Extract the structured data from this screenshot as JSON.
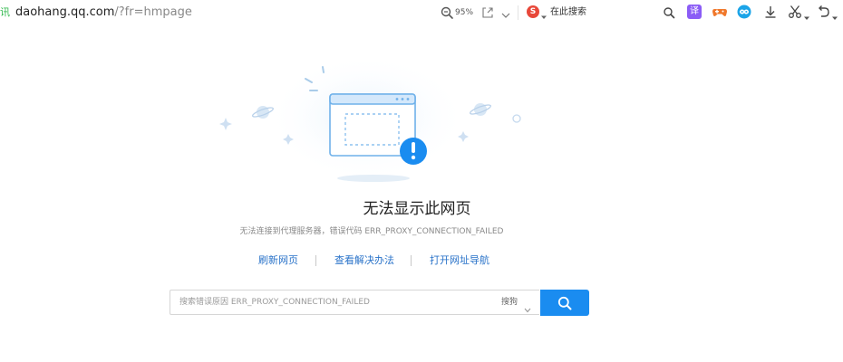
{
  "toolbar": {
    "prefix_text": "讯",
    "address_host": "daohang.qq.com",
    "address_path": "/?fr=hmpage",
    "zoom_level": "95%",
    "engine_logo_text": "S",
    "search_label": "在此搜索",
    "translate_ext_text": "译",
    "icons": [
      "zoom-icon",
      "share-icon",
      "chevron-down-icon",
      "sogou-logo",
      "search-icon",
      "translate-icon",
      "game-icon",
      "extension-icon",
      "download-icon",
      "scissors-icon",
      "undo-icon"
    ]
  },
  "error": {
    "title": "无法显示此网页",
    "description": "无法连接到代理服务器，错误代码 ERR_PROXY_CONNECTION_FAILED"
  },
  "links": {
    "refresh": "刷新网页",
    "solutions": "查看解决办法",
    "open_nav": "打开网址导航"
  },
  "search": {
    "placeholder": "搜索错误原因 ERR_PROXY_CONNECTION_FAILED",
    "engine": "搜狗"
  },
  "colors": {
    "accent": "#1a8cf0",
    "link": "#2a73c9",
    "error_badge": "#1a8cf0"
  }
}
